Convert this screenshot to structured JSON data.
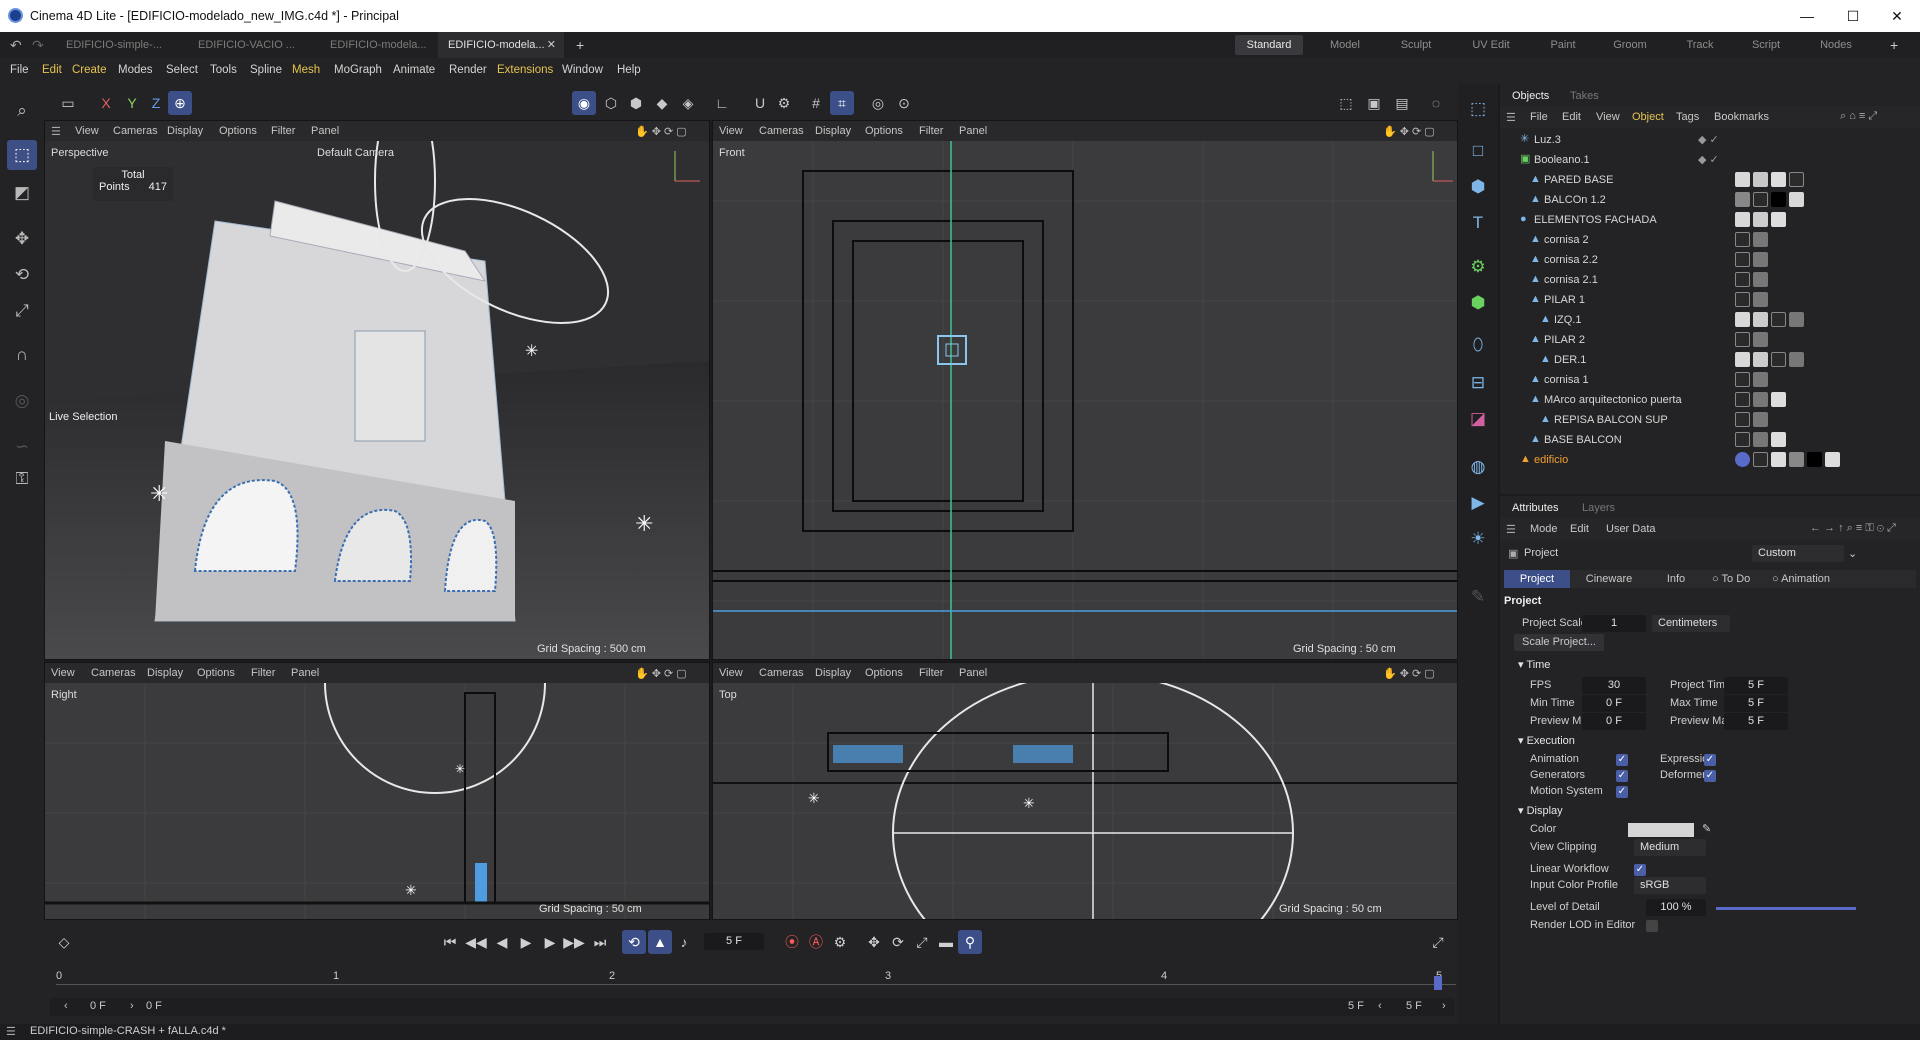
{
  "window": {
    "title": "Cinema 4D Lite - [EDIFICIO-modelado_new_IMG.c4d *] - Principal",
    "min": "—",
    "max": "☐",
    "close": "✕"
  },
  "doc_tabs": [
    {
      "label": "EDIFICIO-simple-..."
    },
    {
      "label": "EDIFICIO-VACIO ..."
    },
    {
      "label": "EDIFICIO-modela..."
    },
    {
      "label": "EDIFICIO-modela..."
    }
  ],
  "doc_tab_close": "✕",
  "doc_tab_add": "+",
  "layouts": [
    "Standard",
    "Model",
    "Sculpt",
    "UV Edit",
    "Paint",
    "Groom",
    "Track",
    "Script",
    "Nodes"
  ],
  "layout_add": "+",
  "menu": [
    "File",
    "Edit",
    "Create",
    "Modes",
    "Select",
    "Tools",
    "Spline",
    "Mesh",
    "MoGraph",
    "Animate",
    "Render",
    "Extensions",
    "Window",
    "Help"
  ],
  "axis_buttons": [
    "X",
    "Y",
    "Z"
  ],
  "viewport_menu": [
    "View",
    "Cameras",
    "Display",
    "Options",
    "Filter",
    "Panel"
  ],
  "viewports": {
    "perspective": {
      "name": "Perspective",
      "camera": "Default Camera",
      "stats_total": "Total",
      "points_label": "Points",
      "points_value": "417",
      "tool": "Live Selection",
      "grid": "Grid Spacing : 500 cm"
    },
    "front": {
      "name": "Front",
      "grid": "Grid Spacing : 50 cm"
    },
    "right": {
      "name": "Right",
      "grid": "Grid Spacing : 50 cm"
    },
    "top": {
      "name": "Top",
      "grid": "Grid Spacing : 50 cm"
    }
  },
  "objects_panel": {
    "tabs": [
      "Objects",
      "Takes"
    ],
    "menu": [
      "File",
      "Edit",
      "View",
      "Object",
      "Tags",
      "Bookmarks"
    ],
    "items": [
      {
        "name": "Luz.3",
        "indent": 0
      },
      {
        "name": "Booleano.1",
        "indent": 0
      },
      {
        "name": "PARED BASE",
        "indent": 1
      },
      {
        "name": "BALCOn 1.2",
        "indent": 1
      },
      {
        "name": "ELEMENTOS FACHADA",
        "indent": 0
      },
      {
        "name": "cornisa 2",
        "indent": 1
      },
      {
        "name": "cornisa 2.2",
        "indent": 1
      },
      {
        "name": "cornisa 2.1",
        "indent": 1
      },
      {
        "name": "PILAR 1",
        "indent": 1
      },
      {
        "name": "IZQ.1",
        "indent": 2
      },
      {
        "name": "PILAR 2",
        "indent": 1
      },
      {
        "name": "DER.1",
        "indent": 2
      },
      {
        "name": "cornisa 1",
        "indent": 1
      },
      {
        "name": "MArco arquitectonico puerta",
        "indent": 1
      },
      {
        "name": "REPISA BALCON SUP",
        "indent": 2
      },
      {
        "name": "BASE BALCON",
        "indent": 1
      },
      {
        "name": "edificio",
        "indent": 0
      }
    ]
  },
  "attributes": {
    "tabs": [
      "Attributes",
      "Layers"
    ],
    "menu": [
      "Mode",
      "Edit",
      "User Data"
    ],
    "object_label": "Project",
    "preset": "Custom",
    "subtabs": [
      "Project",
      "Cineware",
      "Info",
      "To Do",
      "Animation"
    ],
    "section_title": "Project",
    "project_scale_label": "Project Scale",
    "project_scale_value": "1",
    "project_scale_unit": "Centimeters",
    "scale_button": "Scale Project...",
    "time_section": "Time",
    "fps_label": "FPS",
    "fps_value": "30",
    "project_time_label": "Project Time",
    "project_time_value": "5 F",
    "min_time_label": "Min Time",
    "min_time_value": "0 F",
    "max_time_label": "Max Time",
    "max_time_value": "5 F",
    "preview_min_label": "Preview Min",
    "preview_min_value": "0 F",
    "preview_max_label": "Preview Max",
    "preview_max_value": "5 F",
    "execution_section": "Execution",
    "animation_label": "Animation",
    "expression_label": "Expression",
    "generators_label": "Generators",
    "deformers_label": "Deformers",
    "motion_system_label": "Motion System",
    "display_section": "Display",
    "color_label": "Color",
    "view_clipping_label": "View Clipping",
    "view_clipping_value": "Medium",
    "linear_workflow_label": "Linear Workflow",
    "input_color_profile_label": "Input Color Profile",
    "input_color_profile_value": "sRGB",
    "lod_label": "Level of Detail",
    "lod_value": "100 %",
    "render_lod_label": "Render LOD in Editor"
  },
  "timeline": {
    "current_frame": "5 F",
    "ruler_ticks": [
      "0",
      "1",
      "2",
      "3",
      "4",
      "5"
    ],
    "start_field": "0 F",
    "start_field2": "0 F",
    "end_field": "5 F",
    "end_field2": "5 F"
  },
  "status": {
    "text": "EDIFICIO-simple-CRASH + fALLA.c4d *"
  },
  "colors": {
    "accent": "#3d4f88",
    "selection_blue": "#4e9de0",
    "highlight_yellow": "#e5c44f",
    "edificio_orange": "#f0a030",
    "active_green": "#4cc25c"
  }
}
